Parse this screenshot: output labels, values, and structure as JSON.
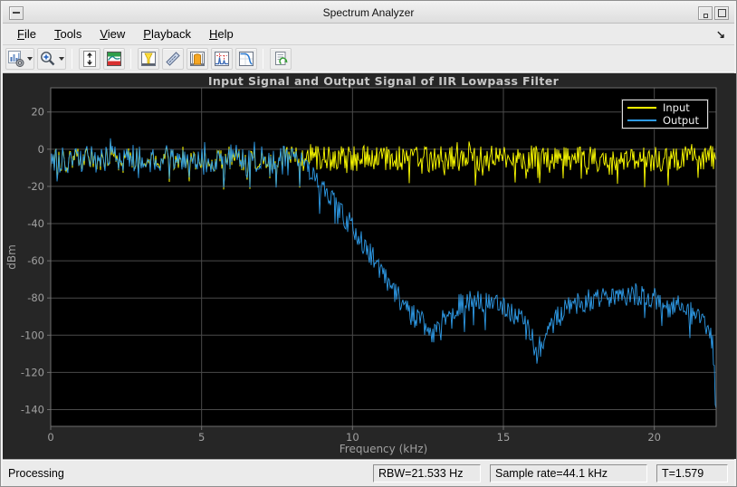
{
  "window": {
    "title": "Spectrum Analyzer"
  },
  "menu": {
    "items": [
      {
        "first": "F",
        "rest": "ile"
      },
      {
        "first": "T",
        "rest": "ools"
      },
      {
        "first": "V",
        "rest": "iew"
      },
      {
        "first": "P",
        "rest": "layback"
      },
      {
        "first": "H",
        "rest": "elp"
      }
    ],
    "overflow_icon": "↘"
  },
  "toolbar": {
    "buttons": [
      {
        "icon": "spectrum-settings-icon",
        "dropdown": true
      },
      {
        "icon": "zoom-in-icon",
        "dropdown": true
      },
      {
        "icon": "fit-to-view-icon",
        "dropdown": false
      },
      {
        "icon": "spectrogram-icon",
        "dropdown": false
      },
      {
        "icon": "cursor-measurements-icon",
        "dropdown": false
      },
      {
        "icon": "signal-statistics-icon",
        "dropdown": false
      },
      {
        "icon": "channel-measurements-icon",
        "dropdown": false
      },
      {
        "icon": "distortion-measurements-icon",
        "dropdown": false
      },
      {
        "icon": "ccdf-measurements-icon",
        "dropdown": false
      },
      {
        "icon": "playback-settings-icon",
        "dropdown": false
      }
    ]
  },
  "status_bar": {
    "left": "Processing",
    "panels": [
      {
        "label": "RBW=21.533 Hz"
      },
      {
        "label": "Sample rate=44.1 kHz"
      },
      {
        "label": "T=1.579"
      }
    ]
  },
  "chart_data": {
    "type": "line",
    "title": "Input Signal and Output Signal of IIR Lowpass Filter",
    "xlabel": "Frequency (kHz)",
    "ylabel": "dBm",
    "xlim": [
      0,
      22.05
    ],
    "ylim": [
      -149,
      33
    ],
    "xticks": [
      0,
      5,
      10,
      15,
      20
    ],
    "yticks": [
      20,
      0,
      -20,
      -40,
      -60,
      -80,
      -100,
      -120,
      -140
    ],
    "grid": true,
    "background": "#000000",
    "panel_background": "#262626",
    "grid_color": "#4a4a4a",
    "axis_color": "#6f6f6f",
    "tick_label_color": "#a0a0a0",
    "title_color": "#c8c8c8",
    "legend": {
      "position": "top-right",
      "background": "#000000",
      "border_color": "#dcdcdc",
      "text_color": "#f0f0f0",
      "entries": [
        {
          "label": "Input",
          "color": "#ffff00"
        },
        {
          "label": "Output",
          "color": "#2e9be8"
        }
      ]
    },
    "series": [
      {
        "name": "Input",
        "color": "#ffff00",
        "envelope_dbm": [
          [
            0,
            -5
          ],
          [
            22.05,
            -5
          ]
        ],
        "noise_db": 7,
        "spike_db": 15,
        "seed": 101
      },
      {
        "name": "Output",
        "color": "#2e9be8",
        "follows_input_below_khz": 8.3,
        "envelope_dbm": [
          [
            0,
            -5
          ],
          [
            8.3,
            -5
          ],
          [
            8.7,
            -13
          ],
          [
            9.0,
            -20
          ],
          [
            9.4,
            -29
          ],
          [
            10.0,
            -42
          ],
          [
            10.5,
            -54
          ],
          [
            11.0,
            -66
          ],
          [
            11.5,
            -79
          ],
          [
            11.9,
            -88
          ],
          [
            12.3,
            -93
          ],
          [
            12.7,
            -99
          ],
          [
            13.0,
            -90
          ],
          [
            13.5,
            -84
          ],
          [
            14.0,
            -81
          ],
          [
            14.6,
            -83
          ],
          [
            15.2,
            -87
          ],
          [
            15.8,
            -94
          ],
          [
            16.1,
            -110
          ],
          [
            16.5,
            -96
          ],
          [
            17.0,
            -86
          ],
          [
            17.6,
            -82
          ],
          [
            18.5,
            -79
          ],
          [
            19.5,
            -78
          ],
          [
            20.5,
            -82
          ],
          [
            21.2,
            -88
          ],
          [
            21.7,
            -95
          ],
          [
            21.95,
            -103
          ],
          [
            22.05,
            -145
          ]
        ],
        "noise_db": 6,
        "spike_db": 17,
        "seed": 202
      }
    ]
  }
}
